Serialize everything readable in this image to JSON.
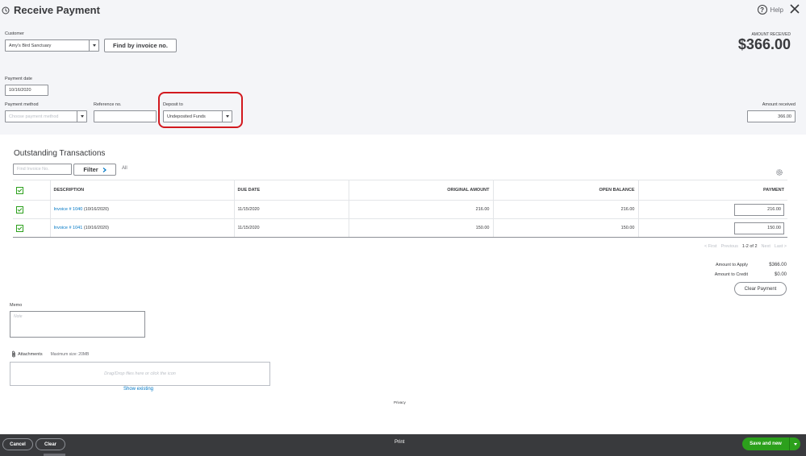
{
  "header": {
    "title": "Receive Payment",
    "help_label": "Help",
    "amount_received_label": "AMOUNT RECEIVED",
    "amount_received_big": "$366.00"
  },
  "form": {
    "customer_label": "Customer",
    "customer_value": "Amy's Bird Sanctuary",
    "find_by_invoice_label": "Find by invoice no.",
    "payment_date_label": "Payment date",
    "payment_date_value": "10/16/2020",
    "payment_method_label": "Payment method",
    "payment_method_placeholder": "Choose payment method",
    "reference_label": "Reference no.",
    "reference_value": "",
    "deposit_to_label": "Deposit to",
    "deposit_to_value": "Undeposited Funds",
    "amount_received_field_label": "Amount received",
    "amount_received_field_value": "366.00"
  },
  "transactions": {
    "title": "Outstanding Transactions",
    "find_placeholder": "Find Invoice No.",
    "filter_label": "Filter",
    "all_label": "All",
    "columns": {
      "description": "DESCRIPTION",
      "due_date": "DUE DATE",
      "original_amount": "ORIGINAL AMOUNT",
      "open_balance": "OPEN BALANCE",
      "payment": "PAYMENT"
    },
    "rows": [
      {
        "invoice_link": "Invoice # 1040",
        "invoice_date": "(10/16/2020)",
        "due_date": "11/15/2020",
        "original_amount": "216.00",
        "open_balance": "216.00",
        "payment": "216.00"
      },
      {
        "invoice_link": "Invoice # 1041",
        "invoice_date": "(10/16/2020)",
        "due_date": "11/15/2020",
        "original_amount": "150.00",
        "open_balance": "150.00",
        "payment": "150.00"
      }
    ],
    "pager": {
      "first": "< First",
      "previous": "Previous",
      "range": "1-2 of 2",
      "next": "Next",
      "last": "Last >"
    }
  },
  "totals": {
    "amount_to_apply_label": "Amount to Apply",
    "amount_to_apply_value": "$366.00",
    "amount_to_credit_label": "Amount to Credit",
    "amount_to_credit_value": "$0.00",
    "clear_payment_label": "Clear Payment"
  },
  "memo": {
    "label": "Memo",
    "placeholder": "Note"
  },
  "attachments": {
    "label": "Attachments",
    "max_size": "Maximum size: 20MB",
    "drop_text": "Drag/Drop files here or click the icon",
    "show_existing": "Show existing"
  },
  "privacy_label": "Privacy",
  "footer": {
    "cancel_label": "Cancel",
    "clear_label": "Clear",
    "print_label": "Print",
    "save_new_label": "Save and new"
  },
  "colors": {
    "accent_green": "#2ca01c",
    "highlight_red": "#d2191f",
    "link_blue": "#0077c5",
    "footer_bg": "#393a3d"
  }
}
